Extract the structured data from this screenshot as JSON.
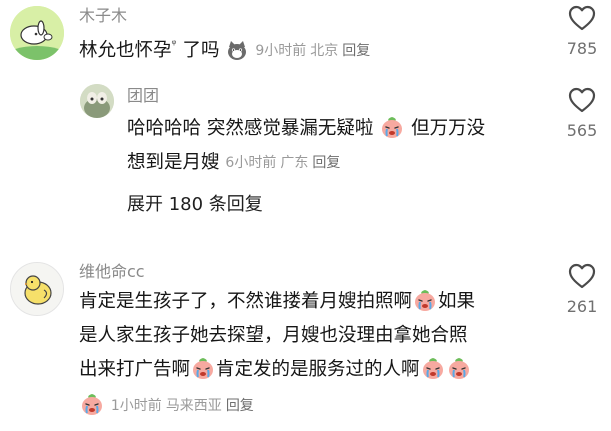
{
  "comments": [
    {
      "username": "木子木",
      "text_parts": [
        "林允也怀孕",
        "了吗"
      ],
      "search_mark": "ᵠ",
      "time": "9小时前",
      "location": "北京",
      "reply_label": "回复",
      "likes": "785"
    },
    {
      "username": "团团",
      "line1_parts": [
        "哈哈哈哈 突然感觉暴漏无疑啦",
        " 但万万没"
      ],
      "line2_text": "想到是月嫂",
      "time": "6小时前",
      "location": "广东",
      "reply_label": "回复",
      "likes": "565"
    },
    {
      "username": "维他命cc",
      "line1_parts": [
        "肯定是生孩子了，不然谁搂着月嫂拍照啊",
        "如果"
      ],
      "line2_text": "是人家生孩子她去探望，月嫂也没理由拿她合照",
      "line3_parts": [
        "出来打广告啊",
        "肯定发的是服务过的人啊"
      ],
      "time": "1小时前",
      "location": "马来西亚",
      "reply_label": "回复",
      "likes": "261"
    }
  ],
  "expand_replies": "展开 180 条回复",
  "icons": {
    "like": "heart-outline-icon",
    "cry": "crying-peach-emoji",
    "cat": "cat-face-emoji"
  },
  "colors": {
    "text": "#161616",
    "meta": "#9a9a9a",
    "username": "#8a8a8a"
  }
}
